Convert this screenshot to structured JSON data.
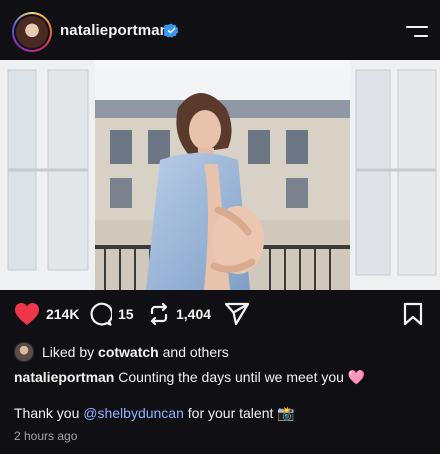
{
  "post": {
    "username": "natalieportman",
    "verified": true,
    "stats": {
      "likes": "214K",
      "comments": "15",
      "reposts": "1,404"
    },
    "liked_by": {
      "prefix": "Liked by",
      "user": "cotwatch",
      "suffix": "and others"
    },
    "caption": {
      "author": "natalieportman",
      "text": "Counting the days until we meet you 🩷"
    },
    "thanks": {
      "prefix": "Thank you",
      "mention": "@shelbyduncan",
      "suffix": "for your talent 📸"
    },
    "time_ago": "2 hours ago"
  },
  "icons": {
    "like": "heart-icon",
    "comment": "comment-bubble-icon",
    "repost": "repost-icon",
    "share": "send-icon",
    "save": "bookmark-icon",
    "menu": "menu-icon",
    "verified": "verified-badge-icon"
  },
  "colors": {
    "background": "#0f0f14",
    "like": "#f0364a",
    "verified": "#3897f0",
    "mention": "#8fb2ff"
  }
}
